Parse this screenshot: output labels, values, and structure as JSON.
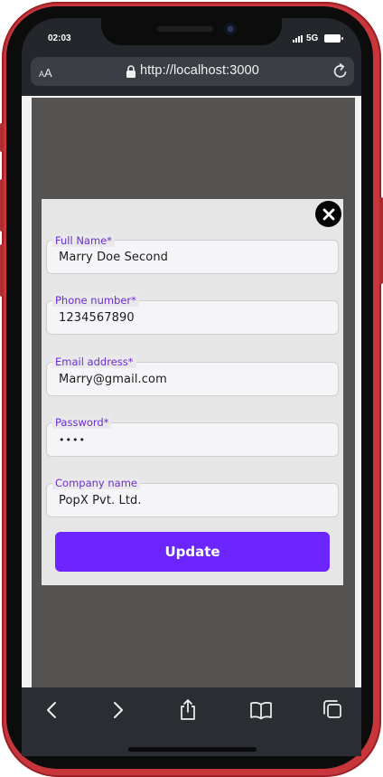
{
  "status_bar": {
    "time": "02:03",
    "network": "5G"
  },
  "browser": {
    "text_size_small": "A",
    "text_size_big": "A",
    "url": "http://localhost:3000",
    "toolbar_icons": [
      "back-icon",
      "forward-icon",
      "share-icon",
      "bookmarks-icon",
      "tabs-icon"
    ]
  },
  "form": {
    "fields": [
      {
        "label": "Full Name*",
        "value": "Marry Doe Second"
      },
      {
        "label": "Phone number*",
        "value": "1234567890"
      },
      {
        "label": "Email address*",
        "value": "Marry@gmail.com"
      },
      {
        "label": "Password*",
        "value": "••••"
      },
      {
        "label": "Company name",
        "value": "PopX Pvt. Ltd."
      }
    ],
    "submit_label": "Update",
    "close_icon": "close-icon"
  },
  "colors": {
    "accent": "#6c25ff",
    "label": "#6b2fd0",
    "phone_frame": "#c8363c",
    "overlay": "#545351"
  }
}
